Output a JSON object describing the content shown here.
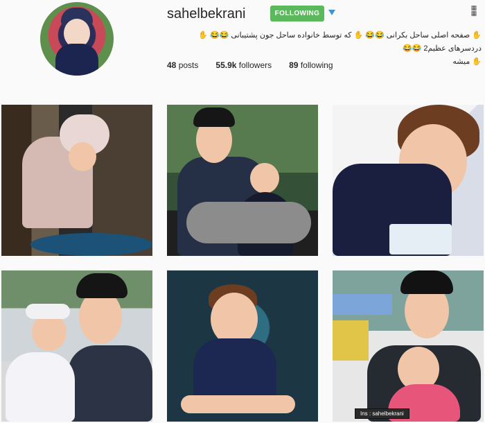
{
  "profile": {
    "username": "sahelbekrani",
    "follow_button": "FOLLOWING",
    "bio_line1_text": "✋ صفحه اصلی ساحل بکرانی 😂😂 ✋ که توسط خانواده ساحل جون پشتیبانی 😂😂 ✋ دردسرهای عظیم2 😂😂",
    "bio_line2_text": "✋ میشه",
    "stats": {
      "posts": "48",
      "posts_label": "posts",
      "followers": "55.9k",
      "followers_label": "followers",
      "following": "89",
      "following_label": "following"
    }
  },
  "posts": [
    {
      "id": 1
    },
    {
      "id": 2
    },
    {
      "id": 3
    },
    {
      "id": 4
    },
    {
      "id": 5
    },
    {
      "id": 6
    }
  ],
  "overlay": {
    "ins_label": "Ins : sahelbekrani"
  },
  "colors": {
    "following": "#5cb85c",
    "dropdown": "#3f93d2",
    "background": "#fafafa"
  },
  "icons": {
    "dropdown": "chevron-down-icon",
    "corner": "watermark-icon"
  }
}
